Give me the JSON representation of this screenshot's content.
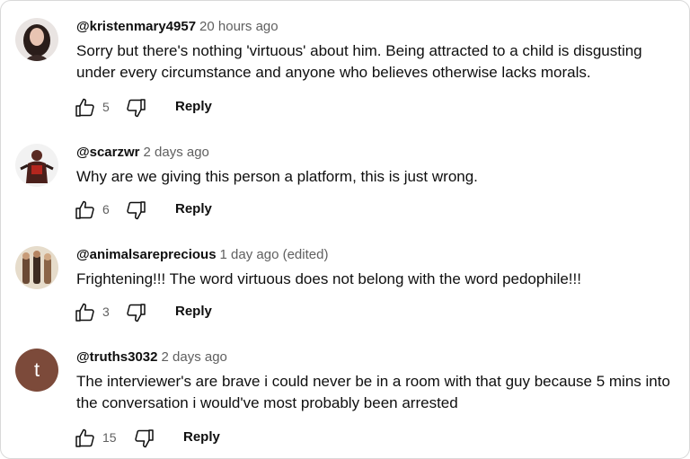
{
  "comments": [
    {
      "author": "@kristenmary4957",
      "time": "20 hours ago",
      "text": "Sorry but there's nothing 'virtuous' about him. Being attracted to a child is disgusting under every circumstance and anyone who believes otherwise lacks morals.",
      "likes": "5",
      "reply": "Reply"
    },
    {
      "author": "@scarzwr",
      "time": "2 days ago",
      "text": "Why are we giving this person a platform, this is just wrong.",
      "likes": "6",
      "reply": "Reply"
    },
    {
      "author": "@animalsareprecious",
      "time": "1 day ago (edited)",
      "text": "Frightening!!! The word virtuous does not belong with the word pedophile!!!",
      "likes": "3",
      "reply": "Reply"
    },
    {
      "author": "@truths3032",
      "time": "2 days ago",
      "text": "The interviewer's are brave i could never be in a room with that guy because 5 mins into the conversation i would've most probably been arrested",
      "likes": "15",
      "reply": "Reply",
      "avatar_letter": "t"
    }
  ]
}
